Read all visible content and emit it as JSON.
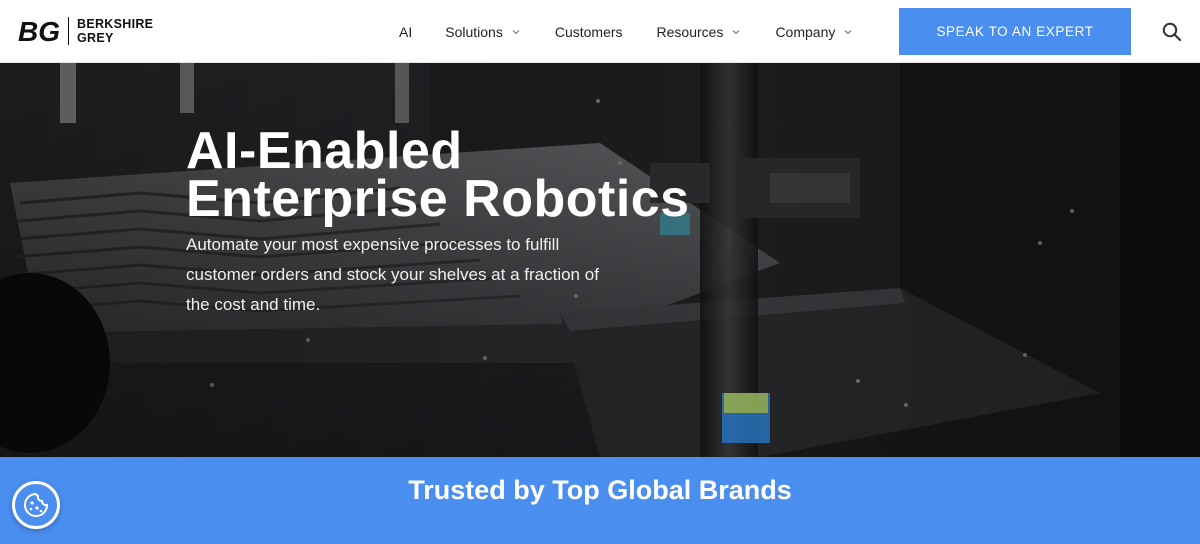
{
  "brand": {
    "line1": "BERKSHIRE",
    "line2": "GREY",
    "mark_letters": "BG"
  },
  "nav": {
    "items": [
      {
        "label": "AI",
        "has_dropdown": false
      },
      {
        "label": "Solutions",
        "has_dropdown": true
      },
      {
        "label": "Customers",
        "has_dropdown": false
      },
      {
        "label": "Resources",
        "has_dropdown": true
      },
      {
        "label": "Company",
        "has_dropdown": true
      }
    ],
    "cta_label": "SPEAK TO AN EXPERT",
    "search_icon": "search-icon"
  },
  "hero": {
    "title_line1": "AI-Enabled",
    "title_line2": "Enterprise Robotics",
    "subtitle": "Automate your most expensive processes to fulfill customer orders and stock your shelves at a fraction of the cost and time."
  },
  "trusted": {
    "title": "Trusted by Top Global Brands"
  },
  "cookie": {
    "icon": "cookie-icon"
  },
  "colors": {
    "accent": "#4a8ef0",
    "hero_bg": "#1c1d1f",
    "text_dark": "#222222"
  }
}
